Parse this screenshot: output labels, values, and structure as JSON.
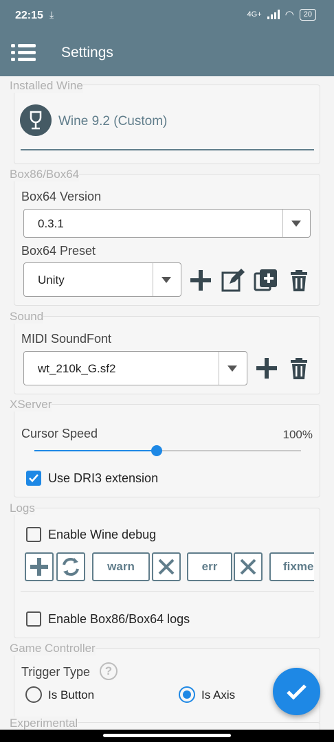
{
  "status": {
    "time": "22:15",
    "network": "4G+",
    "battery": "20"
  },
  "appbar": {
    "title": "Settings"
  },
  "installed_wine": {
    "section_title": "Installed Wine",
    "value": "Wine 9.2 (Custom)"
  },
  "box86": {
    "section_title": "Box86/Box64",
    "version_label": "Box64 Version",
    "version_value": "0.3.1",
    "preset_label": "Box64 Preset",
    "preset_value": "Unity"
  },
  "sound": {
    "section_title": "Sound",
    "soundfont_label": "MIDI SoundFont",
    "soundfont_value": "wt_210k_G.sf2"
  },
  "xserver": {
    "section_title": "XServer",
    "cursor_speed_label": "Cursor Speed",
    "cursor_speed_value": "100%",
    "cursor_speed_fraction": 0.46,
    "dri3_label": "Use DRI3 extension",
    "dri3_checked": true
  },
  "logs": {
    "section_title": "Logs",
    "wine_debug_label": "Enable Wine debug",
    "channels": [
      "warn",
      "err",
      "fixme"
    ],
    "box_logs_label": "Enable Box86/Box64 logs"
  },
  "controller": {
    "section_title": "Game Controller",
    "trigger_label": "Trigger Type",
    "option_button": "Is Button",
    "option_axis": "Is Axis",
    "selected": "Is Axis"
  },
  "experimental": {
    "section_title": "Experimental"
  },
  "colors": {
    "appbar": "#607d8b",
    "accent": "#1e88e5"
  }
}
